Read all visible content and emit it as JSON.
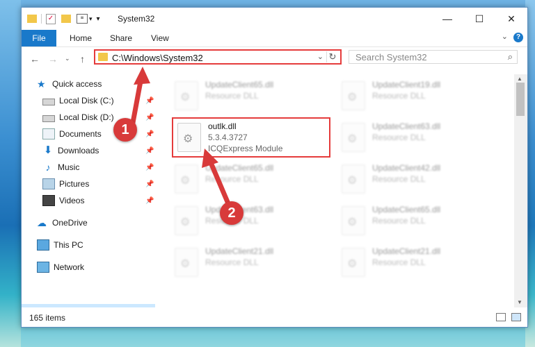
{
  "window": {
    "title": "System32",
    "quick_access_icons": [
      "folder-icon",
      "properties-check-icon",
      "new-folder-icon",
      "customize-icon"
    ]
  },
  "title_controls": {
    "minimize": "—",
    "maximize": "☐",
    "close": "✕"
  },
  "ribbon": {
    "file": "File",
    "tabs": [
      "Home",
      "Share",
      "View"
    ],
    "help": "?"
  },
  "address": {
    "path": "C:\\Windows\\System32",
    "dropdown": "⌄",
    "refresh": "↻"
  },
  "search": {
    "placeholder": "Search System32"
  },
  "sidebar": {
    "quick_access": "Quick access",
    "items": [
      {
        "label": "Local Disk (C:)",
        "icon": "drive-icon",
        "pinned": true
      },
      {
        "label": "Local Disk (D:)",
        "icon": "drive-icon",
        "pinned": true
      },
      {
        "label": "Documents",
        "icon": "documents-icon",
        "pinned": true
      },
      {
        "label": "Downloads",
        "icon": "downloads-icon",
        "pinned": true
      },
      {
        "label": "Music",
        "icon": "music-icon",
        "pinned": true
      },
      {
        "label": "Pictures",
        "icon": "pictures-icon",
        "pinned": true
      },
      {
        "label": "Videos",
        "icon": "videos-icon",
        "pinned": true
      }
    ],
    "onedrive": "OneDrive",
    "this_pc": "This PC",
    "network": "Network"
  },
  "files": {
    "left": [
      {
        "name": "UpdateClient65.dll",
        "type": "Resource DLL"
      },
      {
        "name": "outlk.dll",
        "version": "5.3.4.3727",
        "description": "ICQExpress Module"
      },
      {
        "name": "UpdateClient65.dll",
        "type": "Resource DLL"
      },
      {
        "name": "UpdateClient63.dll",
        "type": "Resource DLL"
      },
      {
        "name": "UpdateClient21.dll",
        "type": "Resource DLL"
      }
    ],
    "right": [
      {
        "name": "UpdateClient19.dll",
        "type": "Resource DLL"
      },
      {
        "name": "UpdateClient63.dll",
        "type": "Resource DLL"
      },
      {
        "name": "UpdateClient42.dll",
        "type": "Resource DLL"
      },
      {
        "name": "UpdateClient65.dll",
        "type": "Resource DLL"
      },
      {
        "name": "UpdateClient21.dll",
        "type": "Resource DLL"
      }
    ]
  },
  "status": {
    "item_count": "165 items"
  },
  "callouts": {
    "one": "1",
    "two": "2",
    "color": "#d83a3a"
  },
  "colors": {
    "accent": "#1979ca",
    "highlight_border": "#e53b3b",
    "selected_bg": "#cce8ff",
    "folder": "#f2c74a"
  }
}
